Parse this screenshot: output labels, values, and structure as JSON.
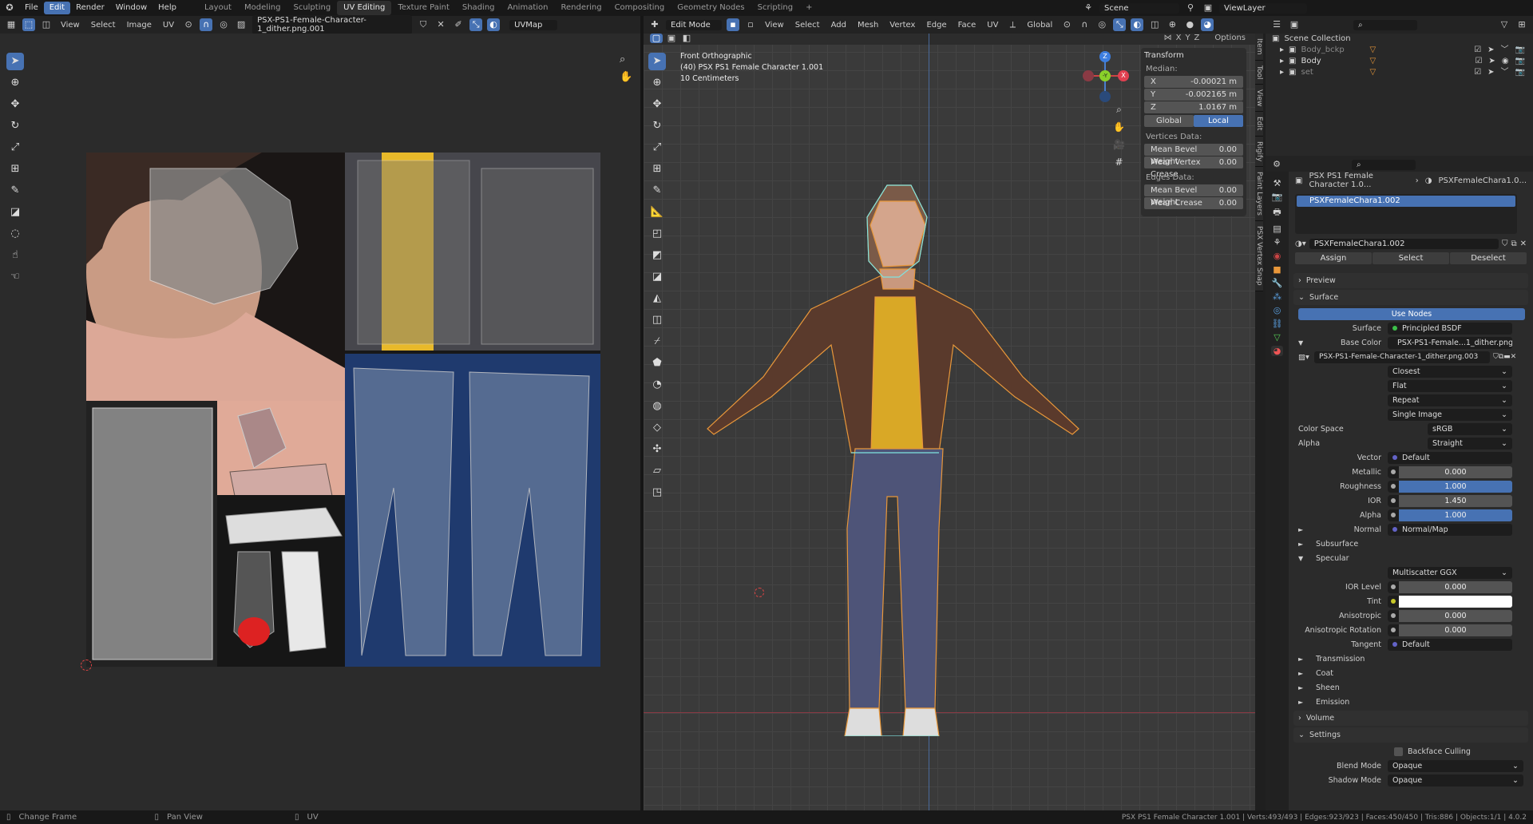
{
  "menu": [
    "File",
    "Edit",
    "Render",
    "Window",
    "Help"
  ],
  "workspaces": [
    "Layout",
    "Modeling",
    "Sculpting",
    "UV Editing",
    "Texture Paint",
    "Shading",
    "Animation",
    "Rendering",
    "Compositing",
    "Geometry Nodes",
    "Scripting"
  ],
  "active_workspace": "UV Editing",
  "scene": {
    "scene_name": "Scene",
    "view_layer": "ViewLayer"
  },
  "uv_header": {
    "menus": [
      "View",
      "Select",
      "Image",
      "UV"
    ],
    "image_name": "PSX-PS1-Female-Character-1_dither.png.001",
    "uvmap": "UVMap"
  },
  "vp_header": {
    "mode": "Edit Mode",
    "menus": [
      "View",
      "Select",
      "Add",
      "Mesh",
      "Vertex",
      "Edge",
      "Face",
      "UV"
    ],
    "orientation": "Global",
    "options": "Options",
    "axes": [
      "X",
      "Y",
      "Z"
    ]
  },
  "viewport_info": {
    "view": "Front Orthographic",
    "object": "(40) PSX PS1 Female Character 1.001",
    "scale": "10 Centimeters"
  },
  "gizmo": {
    "z": "Z",
    "y": "-Y",
    "x": "X"
  },
  "transform": {
    "title": "Transform",
    "median": "Median:",
    "x_label": "X",
    "x": "-0.00021 m",
    "y_label": "Y",
    "y": "-0.002165 m",
    "z_label": "Z",
    "z": "1.0167 m",
    "global": "Global",
    "local": "Local",
    "vertices_data": "Vertices Data:",
    "mbw_label": "Mean Bevel Weight",
    "mbw": "0.00",
    "mvc_label": "Mean Vertex Crease",
    "mvc": "0.00",
    "edges_data": "Edges Data:",
    "embw_label": "Mean Bevel Weight",
    "embw": "0.00",
    "mc_label": "Mean Crease",
    "mc": "0.00"
  },
  "side_tabs": [
    "Item",
    "Tool",
    "View",
    "Edit",
    "Rigify",
    "Paint Layers",
    "PSX Vertex Snap"
  ],
  "outliner": {
    "root": "Scene Collection",
    "items": [
      {
        "name": "Body_bckp",
        "dim": true
      },
      {
        "name": "Body",
        "dim": false
      },
      {
        "name": "set",
        "dim": true
      }
    ]
  },
  "properties": {
    "breadcrumb_object": "PSX PS1 Female Character 1.0...",
    "breadcrumb_material": "PSXFemaleChara1.0...",
    "slot": "PSXFemaleChara1.002",
    "material": "PSXFemaleChara1.002",
    "assign": "Assign",
    "select": "Select",
    "deselect": "Deselect",
    "rows": [
      {
        "t": "header",
        "label": "Preview",
        "open": false
      },
      {
        "t": "header",
        "label": "Surface",
        "open": true
      },
      {
        "t": "button",
        "label": "Use Nodes"
      },
      {
        "t": "socket",
        "label": "Surface",
        "dot": "#3cc04a",
        "value": "Principled BSDF"
      },
      {
        "t": "socket",
        "label": "Base Color",
        "dot": "#c7c729",
        "value": "PSX-PS1-Female...1_dither.png.003",
        "exp": "▼"
      },
      {
        "t": "image",
        "value": "PSX-PS1-Female-Character-1_dither.png.003"
      },
      {
        "t": "dropdown",
        "label": "",
        "value": "Closest"
      },
      {
        "t": "dropdown",
        "label": "",
        "value": "Flat"
      },
      {
        "t": "dropdown",
        "label": "",
        "value": "Repeat"
      },
      {
        "t": "dropdown",
        "label": "",
        "value": "Single Image"
      },
      {
        "t": "dropdown2",
        "label": "Color Space",
        "value": "sRGB"
      },
      {
        "t": "dropdown2",
        "label": "Alpha",
        "value": "Straight"
      },
      {
        "t": "socket",
        "label": "Vector",
        "dot": "#6363c7",
        "value": "Default"
      },
      {
        "t": "slider",
        "label": "Metallic",
        "value": "0.000",
        "fill": 0
      },
      {
        "t": "slider",
        "label": "Roughness",
        "value": "1.000",
        "fill": 1
      },
      {
        "t": "slider",
        "label": "IOR",
        "value": "1.450",
        "fill": 0
      },
      {
        "t": "slider",
        "label": "Alpha",
        "value": "1.000",
        "fill": 1
      },
      {
        "t": "socket",
        "label": "Normal",
        "dot": "#6363c7",
        "value": "Normal/Map",
        "exp": "►"
      },
      {
        "t": "sub",
        "label": "Subsurface",
        "exp": "►"
      },
      {
        "t": "sub",
        "label": "Specular",
        "exp": "▼"
      },
      {
        "t": "dropdown",
        "label": "",
        "value": "Multiscatter GGX"
      },
      {
        "t": "slider",
        "label": "IOR Level",
        "value": "0.000",
        "fill": 0
      },
      {
        "t": "color",
        "label": "Tint",
        "color": "#ffffff"
      },
      {
        "t": "slider",
        "label": "Anisotropic",
        "value": "0.000",
        "fill": 0
      },
      {
        "t": "slider",
        "label": "Anisotropic Rotation",
        "value": "0.000",
        "fill": 0
      },
      {
        "t": "socket",
        "label": "Tangent",
        "dot": "#6363c7",
        "value": "Default"
      },
      {
        "t": "sub",
        "label": "Transmission",
        "exp": "►"
      },
      {
        "t": "sub",
        "label": "Coat",
        "exp": "►"
      },
      {
        "t": "sub",
        "label": "Sheen",
        "exp": "►"
      },
      {
        "t": "sub",
        "label": "Emission",
        "exp": "►"
      },
      {
        "t": "header",
        "label": "Volume",
        "open": false
      },
      {
        "t": "header",
        "label": "Settings",
        "open": true
      },
      {
        "t": "check",
        "label": "Backface Culling"
      },
      {
        "t": "dropdown3",
        "label": "Blend Mode",
        "value": "Opaque"
      },
      {
        "t": "dropdown3",
        "label": "Shadow Mode",
        "value": "Opaque"
      }
    ]
  },
  "status": {
    "left": [
      "Change Frame",
      "Pan View",
      "UV"
    ],
    "right": "PSX PS1 Female Character 1.001 | Verts:493/493 | Edges:923/923 | Faces:450/450 | Tris:886 | Objects:1/1 | 4.0.2"
  },
  "colors": {
    "accent": "#4772b3",
    "wire": "#e8973a",
    "selected": "#7fe3e0"
  }
}
